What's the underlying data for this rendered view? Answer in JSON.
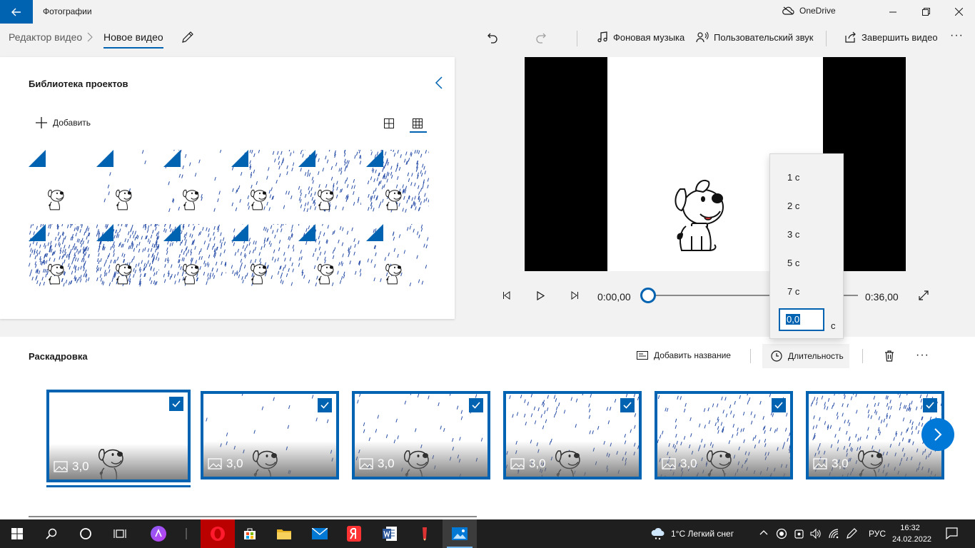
{
  "app": {
    "title": "Фотографии",
    "onedrive_label": "OneDrive"
  },
  "breadcrumb": {
    "parent": "Редактор видео",
    "current": "Новое видео"
  },
  "commands": {
    "background_music": "Фоновая музыка",
    "custom_audio": "Пользовательский звук",
    "finish_video": "Завершить видео",
    "more": "···"
  },
  "library": {
    "title": "Библиотека проектов",
    "add_label": "Добавить",
    "thumbnail_count": 12
  },
  "player": {
    "current_time": "0:00,00",
    "total_time": "0:36,00",
    "progress": 0
  },
  "duration_menu": {
    "options": [
      "1 с",
      "2 с",
      "3 с",
      "5 с",
      "7 с"
    ],
    "custom_value": "0,0",
    "unit": "с"
  },
  "storyboard": {
    "title": "Раскадровка",
    "add_title": "Добавить название",
    "duration": "Длительность",
    "more": "···",
    "clips": [
      {
        "duration": "3,0",
        "checked": true
      },
      {
        "duration": "3,0",
        "checked": true
      },
      {
        "duration": "3,0",
        "checked": true
      },
      {
        "duration": "3,0",
        "checked": true
      },
      {
        "duration": "3,0",
        "checked": true
      },
      {
        "duration": "3,0",
        "checked": true
      }
    ]
  },
  "taskbar": {
    "weather": "1°C  Легкий снег",
    "language": "РУС",
    "time": "16:32",
    "date": "24.02.2022"
  },
  "colors": {
    "accent": "#0063b1",
    "accent_light": "#0078d7",
    "taskbar": "#1f1f1f"
  }
}
